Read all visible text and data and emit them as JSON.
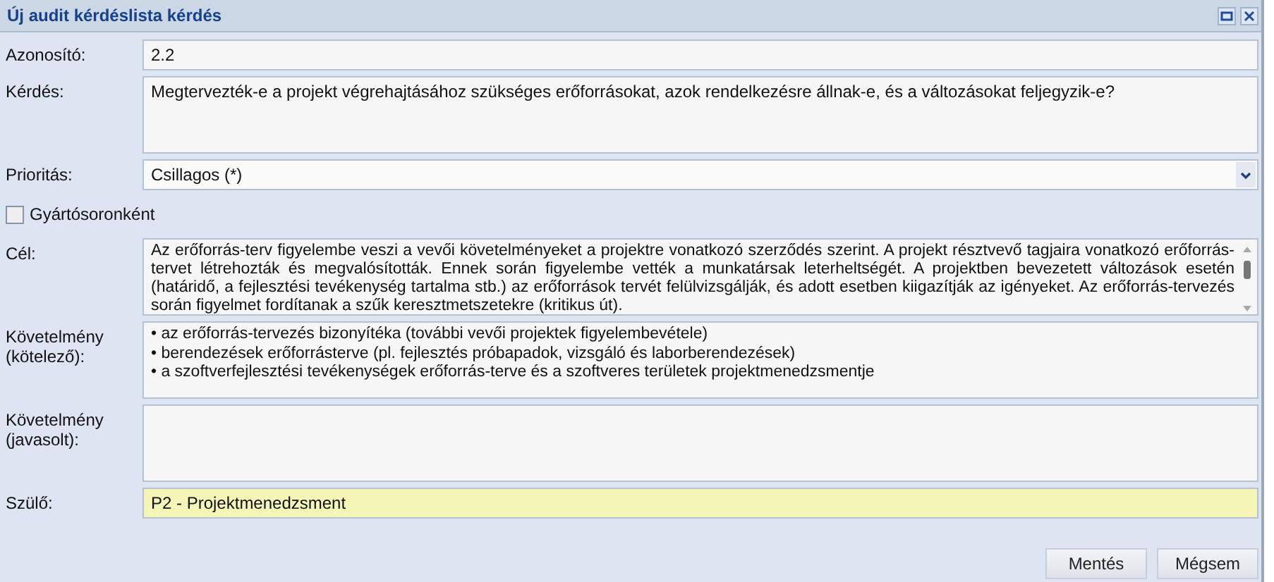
{
  "window": {
    "title": "Új audit kérdéslista kérdés"
  },
  "fields": [
    {
      "kind": "text",
      "label": "Azonosító:",
      "value": "2.2"
    },
    {
      "kind": "textarea",
      "label": "Kérdés:",
      "value": "Megtervezték-e a projekt végrehajtásához szükséges erőforrásokat, azok rendelkezésre állnak-e, és a változásokat feljegyzik-e?"
    },
    {
      "kind": "select",
      "label": "Prioritás:",
      "value": "Csillagos (*)"
    },
    {
      "kind": "checkbox",
      "label": "Gyártósoronként",
      "checked": false
    },
    {
      "kind": "scrolltext",
      "label": "Cél:",
      "value": "Az erőforrás-terv figyelembe veszi a vevői követelményeket a projektre vonatkozó szerződés szerint. A projekt résztvevő tagjaira vonatkozó erőforrás-tervet létrehozták és megvalósították. Ennek során figyelembe vették a munkatársak leterheltségét. A projektben bevezetett változások esetén (határidő, a fejlesztési tevékenység tartalma stb.) az erőforrások tervét felülvizsgálják, és adott esetben kiigazítják az igényeket. Az erőforrás-tervezés során figyelmet fordítanak a szűk keresztmetszetekre (kritikus út)."
    },
    {
      "kind": "lines",
      "label": "Követelmény (kötelező):",
      "lines": [
        "• az erőforrás-tervezés bizonyítéka (további vevői projektek figyelembevétele)",
        "• berendezések erőforrásterve (pl. fejlesztés próbapadok, vizsgáló és laborberendezések)",
        "• a szoftverfejlesztési tevékenységek erőforrás-terve és a szoftveres területek projektmenedzsmentje"
      ]
    },
    {
      "kind": "empty",
      "label": "Követelmény (javasolt):"
    },
    {
      "kind": "readonly",
      "label": "Szülő:",
      "value": "P2 - Projektmenedzsment"
    }
  ],
  "buttons": [
    "Mentés",
    "Mégsem"
  ]
}
